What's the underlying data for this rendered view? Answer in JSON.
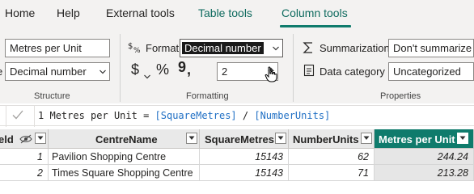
{
  "tabs": [
    {
      "label": "Home"
    },
    {
      "label": "Help"
    },
    {
      "label": "External tools"
    },
    {
      "label": "Table tools"
    },
    {
      "label": "Column tools"
    }
  ],
  "structure": {
    "name_value": "Metres per Unit",
    "datatype_value": "Decimal number",
    "label": "Structure"
  },
  "formatting": {
    "format_label": "Format",
    "format_value": "Decimal number",
    "currency_symbol": "$",
    "percent_symbol": "%",
    "comma_symbol": "9",
    "decimals_value": "2",
    "label": "Formatting"
  },
  "properties": {
    "summarization_label": "Summarization",
    "summarization_value": "Don't summarize",
    "datacategory_label": "Data category",
    "datacategory_value": "Uncategorized",
    "label": "Properties"
  },
  "formula": {
    "line_number": "1",
    "part1": "Metres per Unit = ",
    "ref1": "[SquareMetres]",
    "op": " / ",
    "ref2": "[NumberUnits]"
  },
  "table": {
    "partial_header": "eld",
    "columns": [
      "CentreName",
      "SquareMetres",
      "NumberUnits",
      "Metres per Unit"
    ],
    "rows": [
      {
        "id": "1",
        "CentreName": "Pavilion Shopping Centre",
        "SquareMetres": "15143",
        "NumberUnits": "62",
        "MetresPerUnit": "244.24"
      },
      {
        "id": "2",
        "CentreName": "Times Square Shopping Centre",
        "SquareMetres": "15143",
        "NumberUnits": "71",
        "MetresPerUnit": "213.28"
      }
    ]
  },
  "colors": {
    "accent": "#0f7b6c",
    "ribbon_bg": "#f3f2f1",
    "formula_ref": "#1f6fc4"
  }
}
